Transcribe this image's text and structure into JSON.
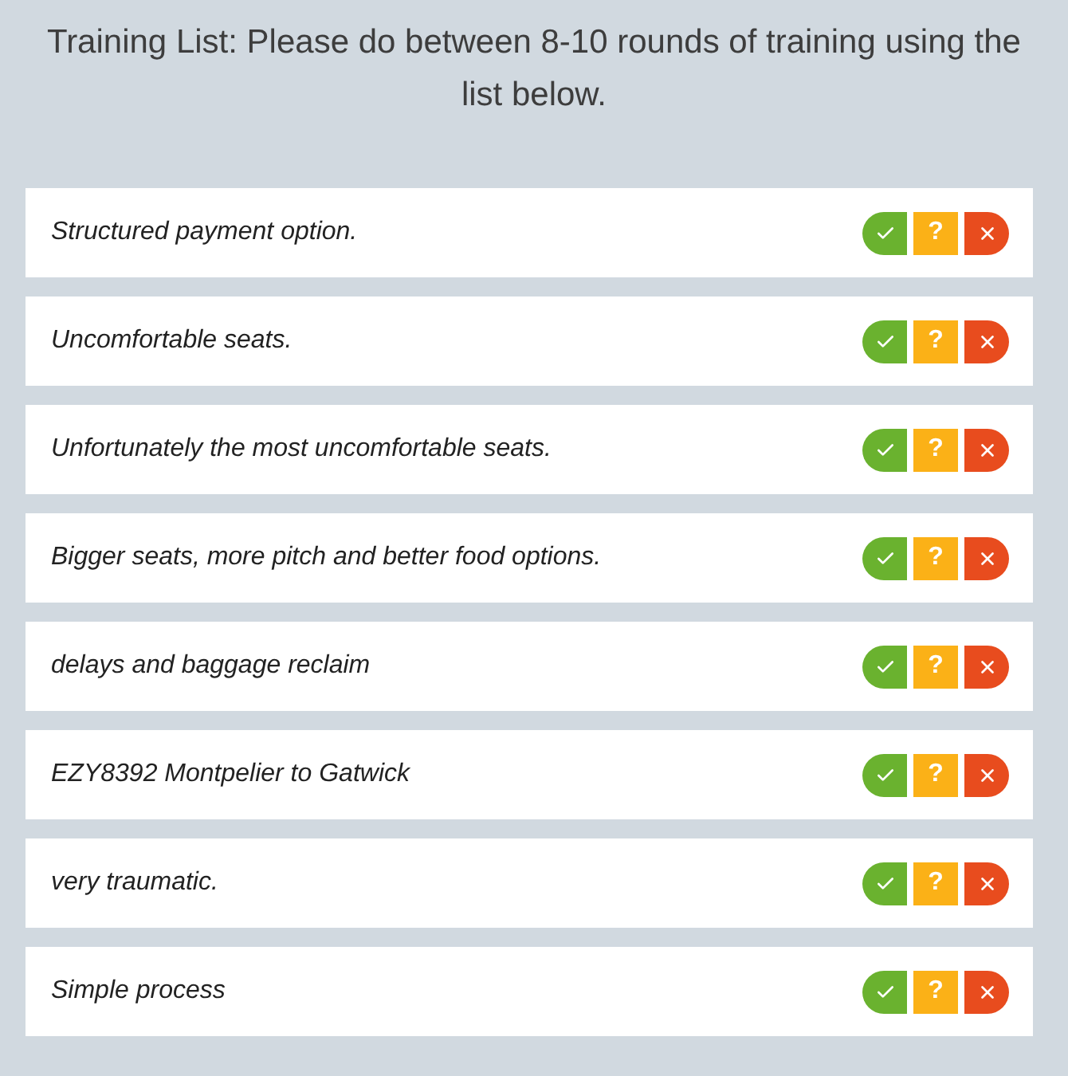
{
  "heading": "Training List: Please do between 8-10 rounds of training using the list below.",
  "items": [
    {
      "text": "Structured payment option.",
      "unsure_label": "?"
    },
    {
      "text": "Uncomfortable seats.",
      "unsure_label": "?"
    },
    {
      "text": "Unfortunately the most uncomfortable seats.",
      "unsure_label": "?"
    },
    {
      "text": "Bigger seats, more pitch and better food options.",
      "unsure_label": "?"
    },
    {
      "text": "delays and baggage reclaim",
      "unsure_label": "?"
    },
    {
      "text": "EZY8392 Montpelier to Gatwick",
      "unsure_label": "?"
    },
    {
      "text": "very traumatic.",
      "unsure_label": "?"
    },
    {
      "text": "Simple process",
      "unsure_label": "?"
    }
  ]
}
